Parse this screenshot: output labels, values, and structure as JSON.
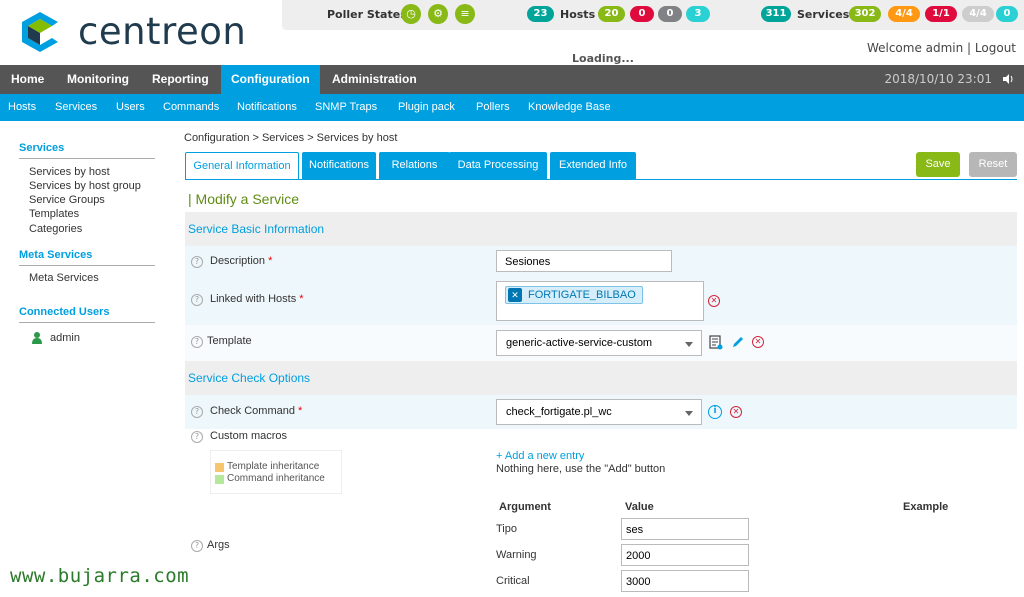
{
  "header": {
    "logo_text": "centreon",
    "poller_states_label": "Poller States",
    "hosts": {
      "label": "Hosts",
      "total": "23",
      "up": "20",
      "down": "0",
      "unreachable": "0",
      "pending": "3"
    },
    "services": {
      "label": "Services",
      "total": "311",
      "ok": "302",
      "warning": "4/4",
      "critical": "1/1",
      "unknown": "4/4",
      "pending": "0"
    },
    "loading": "Loading...",
    "welcome": "Welcome admin | Logout"
  },
  "colors": {
    "brand_blue": "#009fdf",
    "green": "#88b917",
    "orange": "#ff9913",
    "red": "#e00b3d",
    "grey": "#818285",
    "teal": "#2ad1d4",
    "dark_teal": "#00a499"
  },
  "nav": {
    "main": [
      "Home",
      "Monitoring",
      "Reporting",
      "Configuration",
      "Administration"
    ],
    "active": "Configuration",
    "datetime": "2018/10/10 23:01",
    "sub": [
      "Hosts",
      "Services",
      "Users",
      "Commands",
      "Notifications",
      "SNMP Traps",
      "Plugin pack",
      "Pollers",
      "Knowledge Base"
    ]
  },
  "sidebar": {
    "services_title": "Services",
    "services_items": [
      "Services by host",
      "Services by host group",
      "Service Groups",
      "Templates",
      "Categories"
    ],
    "meta_title": "Meta Services",
    "meta_items": [
      "Meta Services"
    ],
    "users_title": "Connected Users",
    "users": [
      "admin"
    ]
  },
  "main": {
    "breadcrumb": "Configuration  >  Services  >  Services by host",
    "tabs": [
      "General Information",
      "Notifications",
      "Relations",
      "Data Processing",
      "Extended Info"
    ],
    "save_label": "Save",
    "reset_label": "Reset",
    "page_title": "| Modify a Service",
    "section_basic": "Service Basic Information",
    "section_check": "Service Check Options",
    "fields": {
      "description_label": "Description",
      "description_value": "Sesiones",
      "linked_hosts_label": "Linked with Hosts",
      "linked_host": "FORTIGATE_BILBAO",
      "template_label": "Template",
      "template_value": "generic-active-service-custom",
      "check_command_label": "Check Command",
      "check_command_value": "check_fortigate.pl_wc",
      "custom_macros_label": "Custom macros",
      "args_label": "Args"
    },
    "macros": {
      "legend_template": "Template inheritance",
      "legend_command": "Command inheritance",
      "add_entry": "+ Add a new entry",
      "nothing": "Nothing here, use the \"Add\" button"
    },
    "args_table": {
      "headers": [
        "Argument",
        "Value",
        "Example"
      ],
      "rows": [
        {
          "name": "Tipo",
          "value": "ses"
        },
        {
          "name": "Warning",
          "value": "2000"
        },
        {
          "name": "Critical",
          "value": "3000"
        }
      ]
    }
  },
  "watermark": "www.bujarra.com"
}
